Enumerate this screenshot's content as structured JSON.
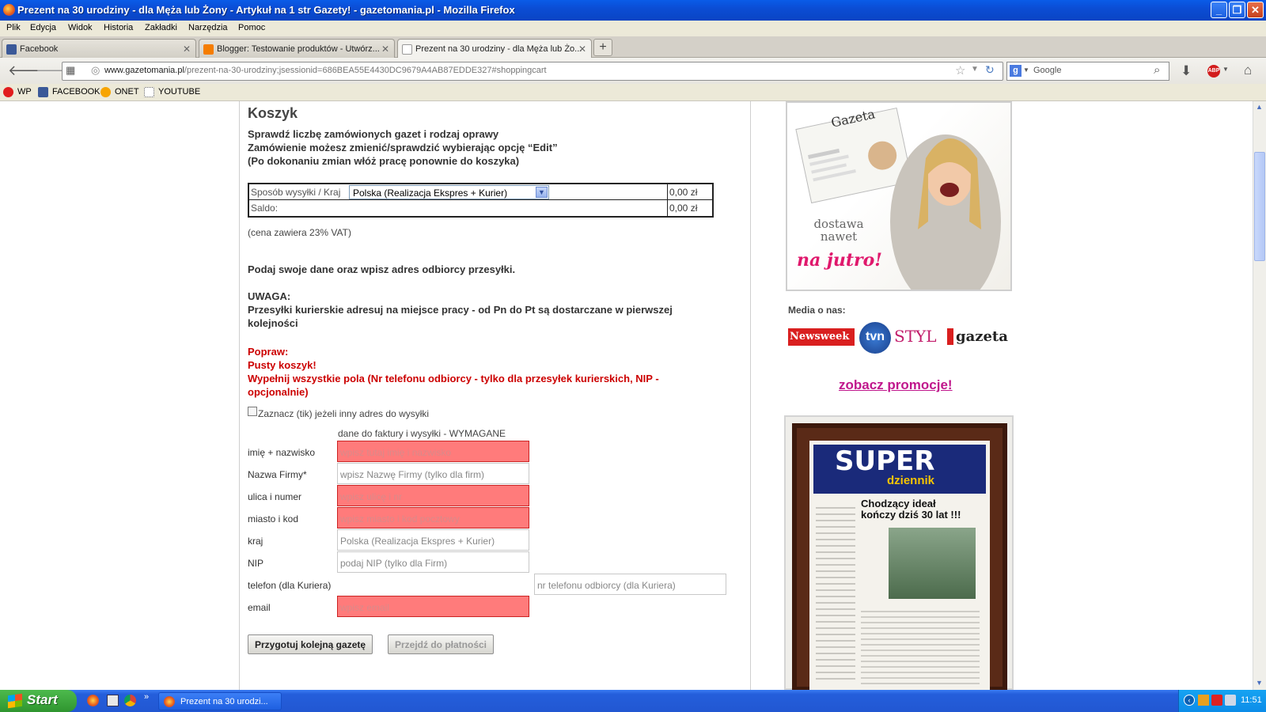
{
  "window": {
    "title": "Prezent na 30 urodziny - dla Męża lub Żony - Artykuł na 1 str Gazety! - gazetomania.pl - Mozilla Firefox"
  },
  "menu": [
    "Plik",
    "Edycja",
    "Widok",
    "Historia",
    "Zakładki",
    "Narzędzia",
    "Pomoc"
  ],
  "tabs": [
    {
      "label": "Facebook",
      "active": false,
      "icon_color": "#3b5998"
    },
    {
      "label": "Blogger: Testowanie produktów - Utwórz...",
      "active": false,
      "icon_color": "#f57d00"
    },
    {
      "label": "Prezent na 30 urodziny - dla Męża lub Żo...",
      "active": true,
      "icon_color": "#ffffff"
    }
  ],
  "url": {
    "domain": "www.gazetomania.pl",
    "path": "/prezent-na-30-urodziny;jsessionid=686BEA55E4430DC9679A4AB87EDDE327#shoppingcart"
  },
  "search": {
    "placeholder": "Google"
  },
  "bookmarks": [
    {
      "label": "WP",
      "icon_color": "#e11d1d"
    },
    {
      "label": "FACEBOOK",
      "icon_color": "#3b5998"
    },
    {
      "label": "ONET",
      "icon_color": "#f7a400"
    },
    {
      "label": "YOUTUBE",
      "icon_color": "#ffffff"
    }
  ],
  "page": {
    "heading": "Koszyk",
    "intro1": "Sprawdź liczbę zamówionych gazet i rodzaj oprawy",
    "intro2": "Zamówienie możesz zmienić/sprawdzić wybierając opcję “Edit”",
    "intro3": "(Po dokonaniu zmian włóż pracę ponownie do koszyka)",
    "cart": {
      "shipping_label": "Sposób wysyłki / Kraj",
      "shipping_value": "Polska (Realizacja Ekspres + Kurier)",
      "shipping_price": "0,00 zł",
      "balance_label": "Saldo:",
      "balance_value": "0,00 zł"
    },
    "vat_note": "(cena zawiera 23% VAT)",
    "address_prompt": "Podaj swoje dane oraz wpisz adres odbiorcy przesyłki.",
    "warning_title": "UWAGA:",
    "warning_text1": "Przesyłki kurierskie adresuj na miejsce pracy - od Pn do Pt są dostarczane w pierwszej",
    "warning_text2": "kolejności",
    "errors": {
      "title": "Popraw:",
      "line1": "Pusty koszyk!",
      "line2": "Wypełnij wszystkie pola (Nr telefonu odbiorcy - tylko dla przesyłek kurierskich, NIP -",
      "line3": "opcjonalnie)"
    },
    "other_address_checkbox": "Zaznacz (tik) jeżeli inny adres do wysyłki",
    "form_header": "dane do faktury i wysyłki - WYMAGANE",
    "form": {
      "name_label": "imię + nazwisko",
      "name_ph": "wpisz tutaj imię i nazwisko",
      "company_label": "Nazwa Firmy*",
      "company_ph": "wpisz Nazwę Firmy (tylko dla firm)",
      "street_label": "ulica i numer",
      "street_ph": "wpisz ulicę i nr",
      "city_label": "miasto i kod",
      "city_ph": "wpisz miasto i kod pocztowy",
      "country_label": "kraj",
      "country_value": "Polska (Realizacja Ekspres + Kurier)",
      "nip_label": "NIP",
      "nip_ph": "podaj NIP (tylko dla Firm)",
      "phone_label": "telefon (dla Kuriera)",
      "phone_ph": "nr telefonu odbiorcy (dla Kuriera)",
      "email_label": "email",
      "email_ph": "wpisz email"
    },
    "buttons": {
      "prepare": "Przygotuj kolejną gazetę",
      "pay": "Przejdź do płatności"
    }
  },
  "sidebar": {
    "ad": {
      "newspaper": "Gazeta",
      "line1": "dostawa",
      "line2": "nawet",
      "line3": "na jutro!"
    },
    "media_title": "Media o nas:",
    "media_logos": [
      "Newsweek",
      "tvn",
      "STYL",
      "gazeta"
    ],
    "promo_link": "zobacz promocje!",
    "frame": {
      "masthead": "SUPER",
      "sub": "dziennik",
      "headline1": "Chodzący ideał",
      "headline2": "kończy dziś 30 lat !!!"
    }
  },
  "taskbar": {
    "start": "Start",
    "item": "Prezent na 30 urodzi...",
    "clock": "11:51"
  }
}
